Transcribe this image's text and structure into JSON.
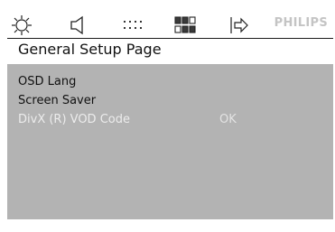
{
  "toolbar": {
    "icons": [
      {
        "name": "general-setup-icon"
      },
      {
        "name": "audio-setup-icon"
      },
      {
        "name": "dolby-setup-icon"
      },
      {
        "name": "video-setup-icon"
      },
      {
        "name": "preference-exit-icon"
      }
    ],
    "brand": "PHILIPS"
  },
  "page": {
    "title": "General Setup Page"
  },
  "menu": {
    "items": [
      {
        "label": "OSD Lang",
        "value": ""
      },
      {
        "label": "Screen Saver",
        "value": ""
      },
      {
        "label": "DivX (R) VOD Code",
        "value": "OK"
      }
    ]
  },
  "colors": {
    "panel_background": "#b3b3b3",
    "brand_text": "#c4c4c4",
    "disabled_text": "#ececec"
  }
}
